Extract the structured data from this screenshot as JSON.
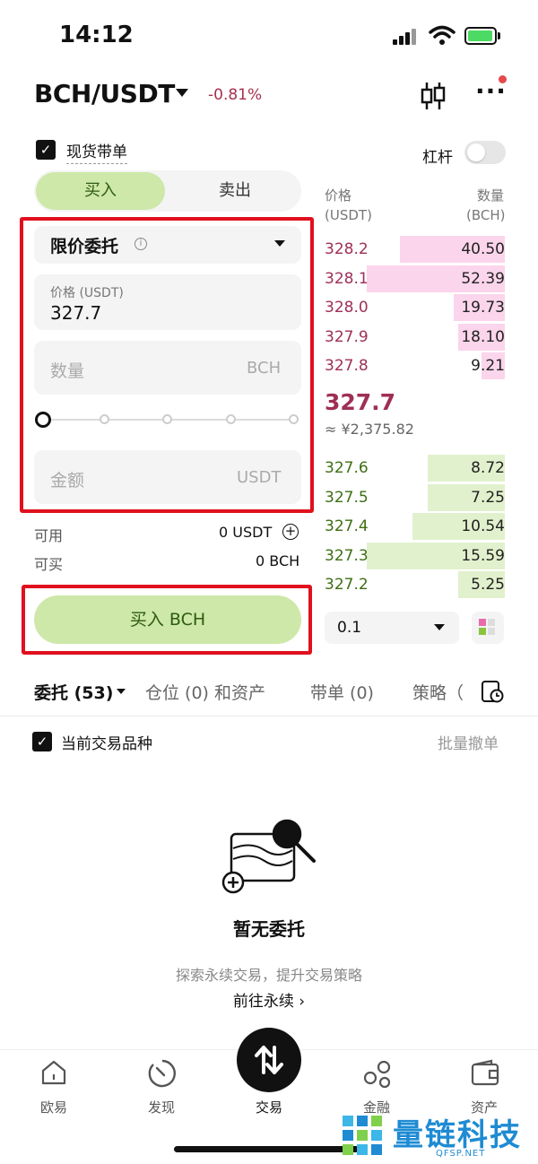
{
  "status_bar": {
    "time": "14:12"
  },
  "header": {
    "pair": "BCH/USDT",
    "change": "-0.81%"
  },
  "spot": {
    "with_order_label": "现货带单",
    "leverage_label": "杠杆",
    "leverage_on": false
  },
  "side_tabs": {
    "buy": "买入",
    "sell": "卖出",
    "active": "buy"
  },
  "order_form": {
    "order_type": "限价委托",
    "price_label": "价格 (USDT)",
    "price_value": "327.7",
    "qty_placeholder": "数量",
    "qty_unit": "BCH",
    "slider_percent": 0,
    "amount_placeholder": "金额",
    "amount_unit": "USDT"
  },
  "balance": {
    "available_label": "可用",
    "available_value": "0 USDT",
    "can_buy_label": "可买",
    "can_buy_value": "0 BCH"
  },
  "buy_button": "买入 BCH",
  "order_book": {
    "price_header": "价格",
    "price_unit": "(USDT)",
    "qty_header": "数量",
    "qty_unit": "(BCH)",
    "asks": [
      {
        "price": "328.2",
        "qty": "40.50",
        "depth": 0.76
      },
      {
        "price": "328.1",
        "qty": "52.39",
        "depth": 1.0
      },
      {
        "price": "328.0",
        "qty": "19.73",
        "depth": 0.37
      },
      {
        "price": "327.9",
        "qty": "18.10",
        "depth": 0.34
      },
      {
        "price": "327.8",
        "qty": "9.21",
        "depth": 0.17
      }
    ],
    "last_price": "327.7",
    "last_price_cny": "≈ ¥2,375.82",
    "bids": [
      {
        "price": "327.6",
        "qty": "8.72",
        "depth": 0.56
      },
      {
        "price": "327.5",
        "qty": "7.25",
        "depth": 0.56
      },
      {
        "price": "327.4",
        "qty": "10.54",
        "depth": 0.67
      },
      {
        "price": "327.3",
        "qty": "15.59",
        "depth": 1.0
      },
      {
        "price": "327.2",
        "qty": "5.25",
        "depth": 0.34
      }
    ],
    "depth_value": "0.1"
  },
  "bottom_tabs": [
    {
      "label": "委托 (53)"
    },
    {
      "label": "仓位 (0) 和资产"
    },
    {
      "label": "带单 (0)"
    },
    {
      "label": "策略（"
    }
  ],
  "filter": {
    "current_label": "当前交易品种",
    "batch_cancel": "批量撤单"
  },
  "empty_state": {
    "title": "暂无委托",
    "subtitle": "探索永续交易，提升交易策略",
    "link": "前往永续 ›"
  },
  "nav": {
    "home": "欧易",
    "discover": "发现",
    "trade": "交易",
    "finance": "金融",
    "assets": "资产"
  },
  "watermark": {
    "text": "量链科技",
    "sub": "QFSP.NET"
  },
  "colors": {
    "ask_text": "#9e2f57",
    "ask_bar": "#fbd5ec",
    "bid_text": "#3e6e14",
    "bid_bar": "#e2f1cd",
    "buy_accent": "#cde8a8",
    "highlight_box": "#e0101e"
  }
}
